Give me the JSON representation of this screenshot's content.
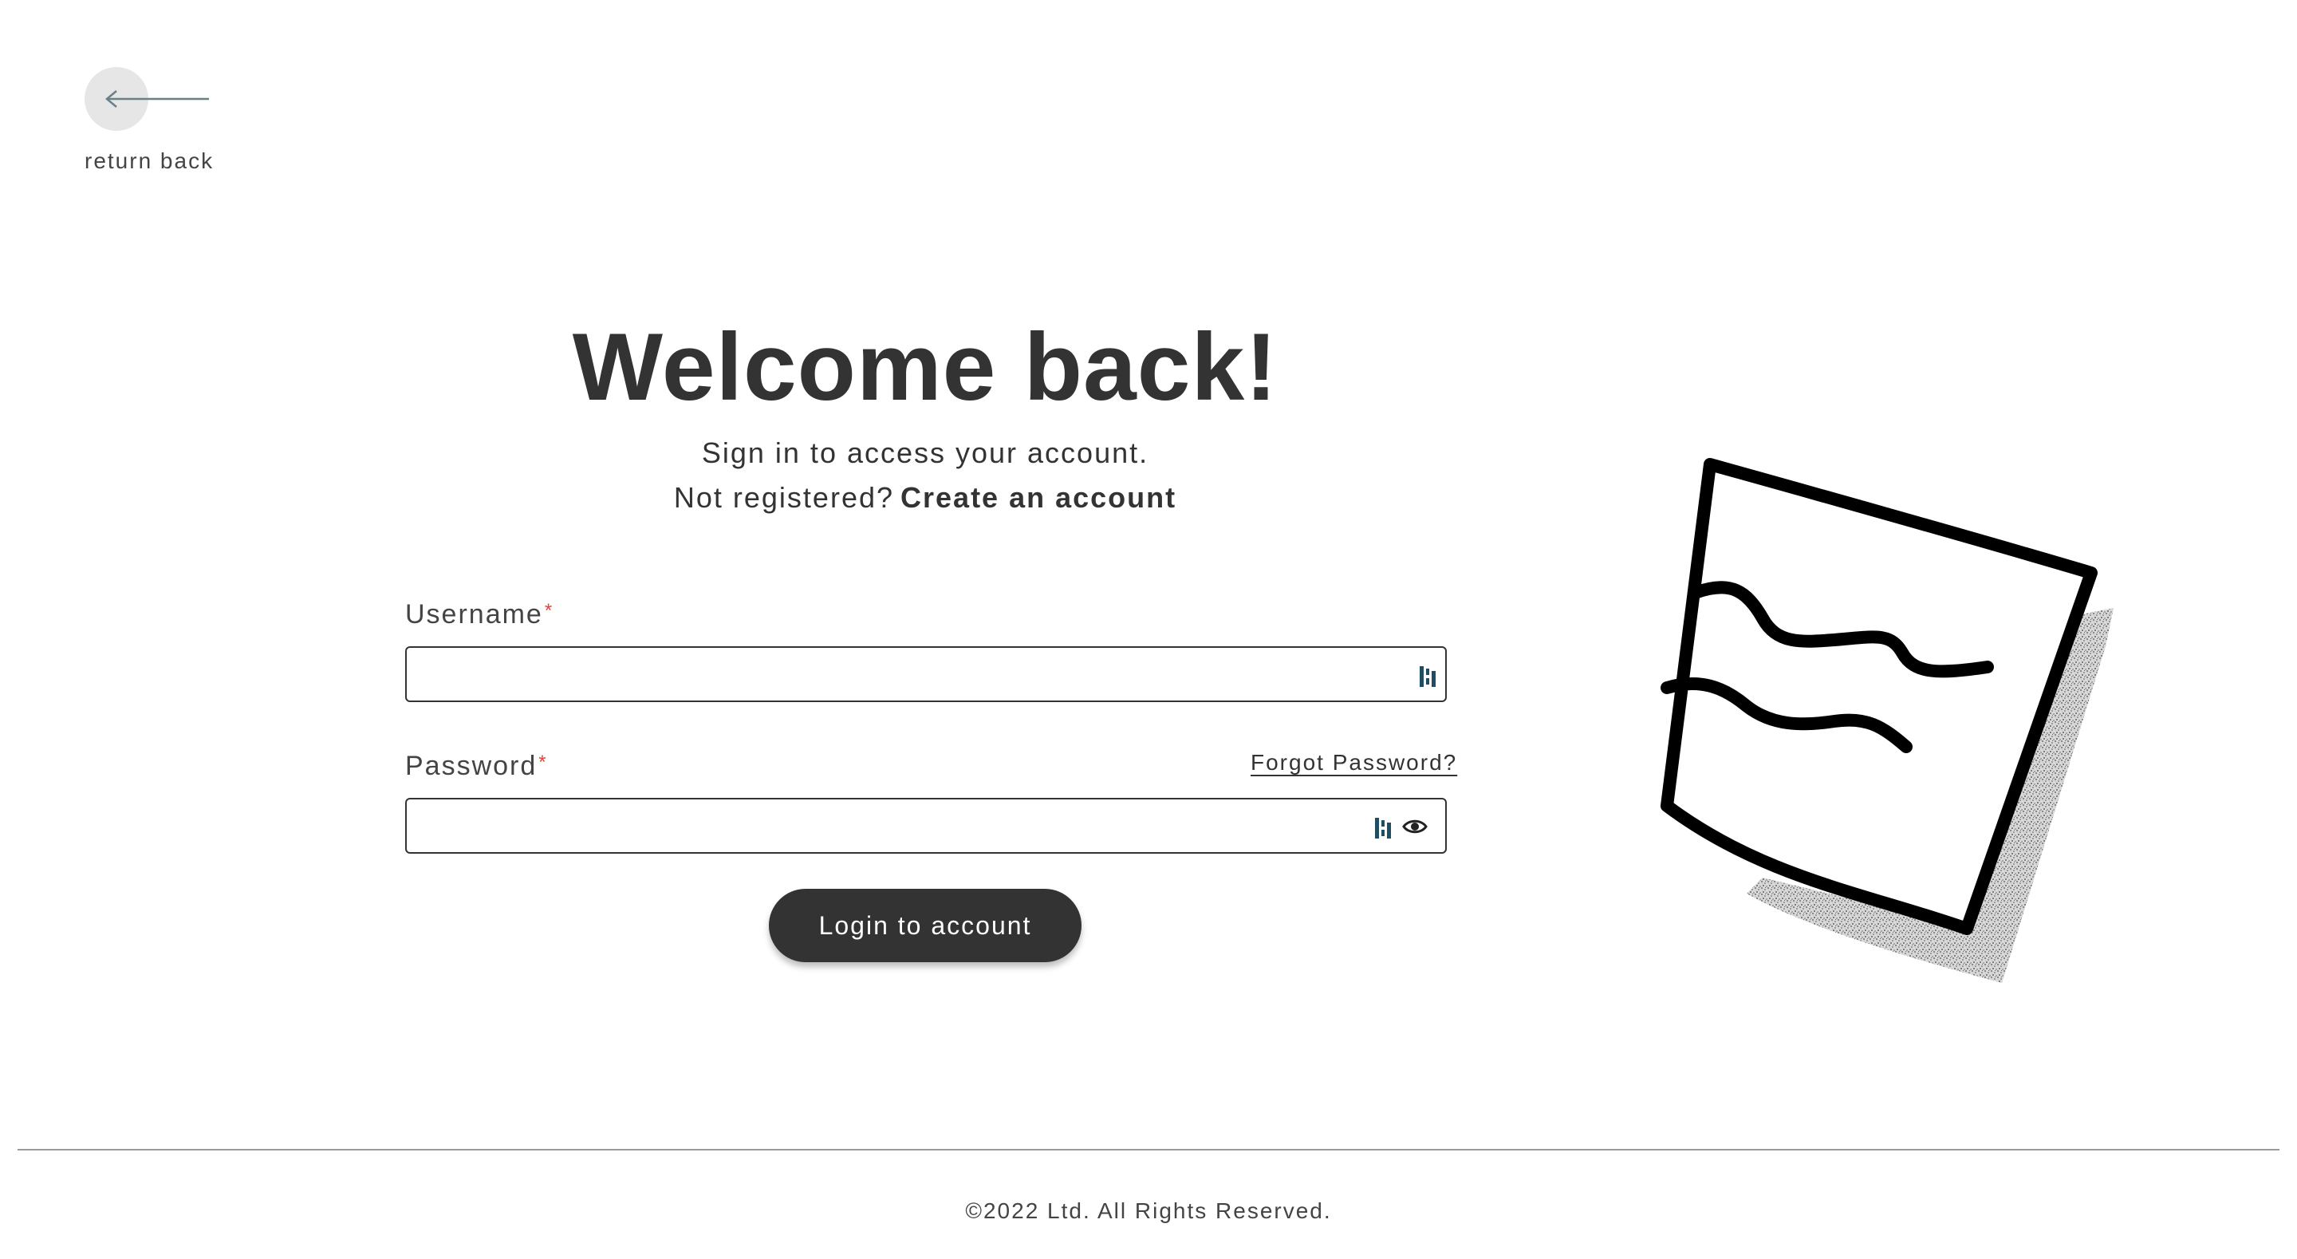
{
  "nav": {
    "back_label": "return back"
  },
  "header": {
    "title": "Welcome back!",
    "subtitle": "Sign in to access your account.",
    "register_prompt": "Not registered?",
    "register_link": "Create an account"
  },
  "form": {
    "username": {
      "label": "Username",
      "required_marker": "*",
      "value": ""
    },
    "password": {
      "label": "Password",
      "required_marker": "*",
      "value": ""
    },
    "forgot_link": "Forgot Password?",
    "submit_label": "Login to account"
  },
  "footer": {
    "copyright": "©2022 Ltd. All Rights Reserved."
  },
  "colors": {
    "text": "#333333",
    "required": "#e2443a",
    "button_bg": "#333333",
    "button_text": "#ffffff",
    "back_circle": "#e6e6e6",
    "password_manager_icon": "#1f4e63"
  },
  "icons": {
    "back": "arrow-left-icon",
    "password_manager": "password-manager-icon",
    "toggle_visibility": "eye-icon",
    "illustration": "wavy-note-illustration"
  }
}
